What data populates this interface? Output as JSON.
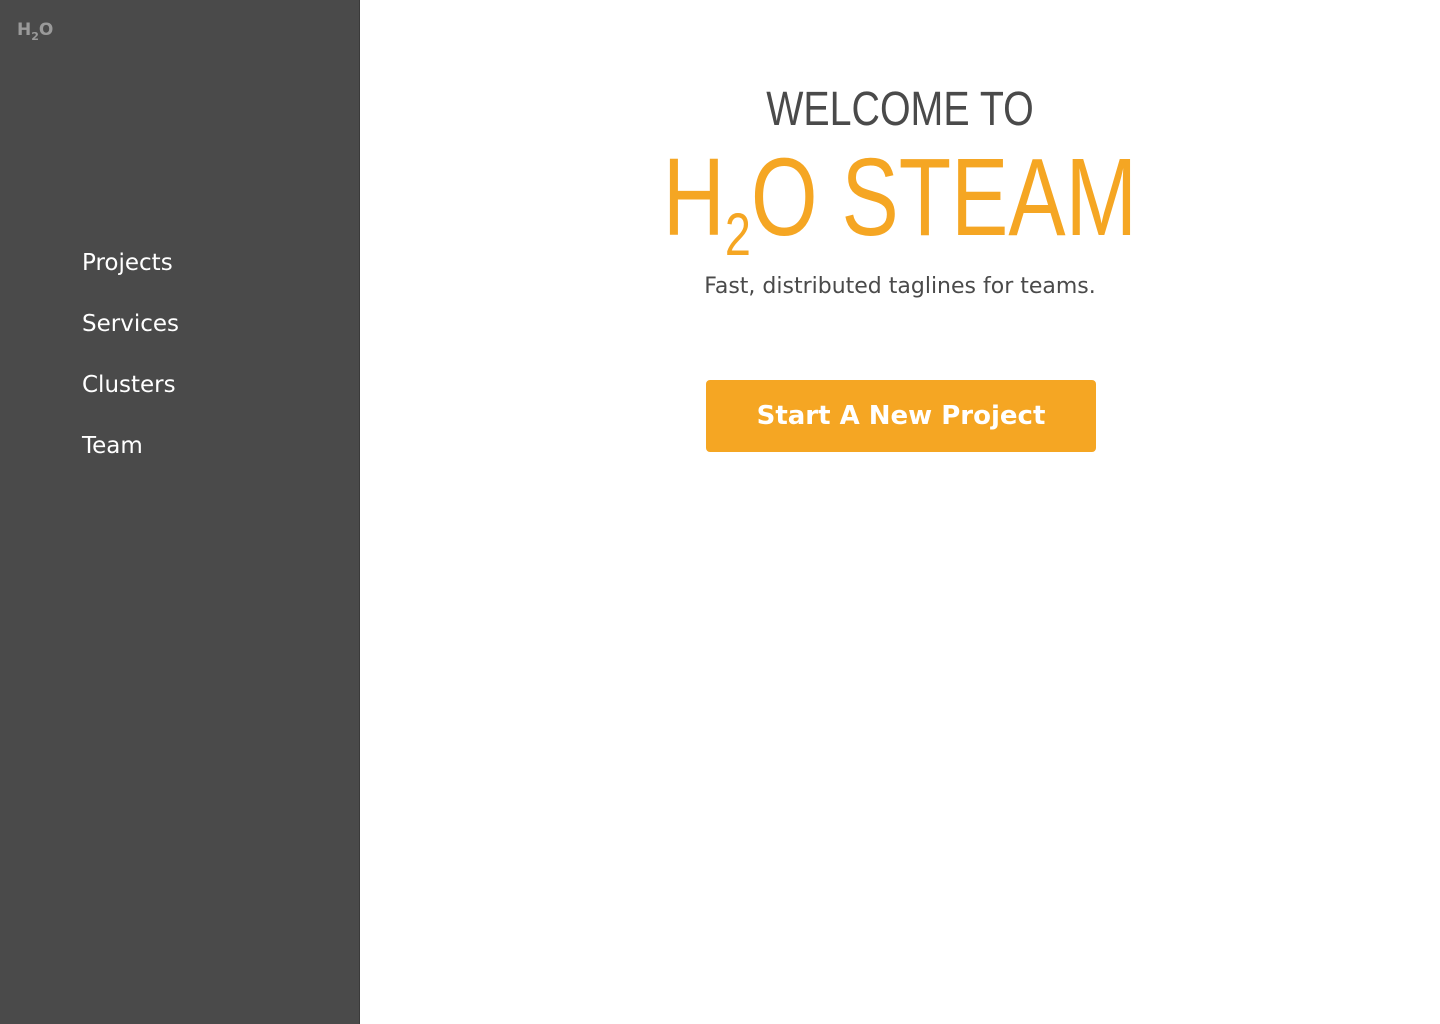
{
  "app": {
    "logo": {
      "main": "H",
      "subscript": "2",
      "tail": "O"
    }
  },
  "sidebar": {
    "items": [
      {
        "label": "Projects"
      },
      {
        "label": "Services"
      },
      {
        "label": "Clusters"
      },
      {
        "label": "Team"
      }
    ]
  },
  "main": {
    "welcome": "WELCOME TO",
    "hero": {
      "prefix": "H",
      "subscript": "2",
      "suffix": "O STEAM"
    },
    "tagline": "Fast, distributed taglines for teams.",
    "cta_label": "Start A New Project"
  },
  "colors": {
    "sidebar_bg": "#4a4a4a",
    "accent": "#f5a623",
    "text_dark": "#4a4a4a",
    "text_light": "#ffffff"
  }
}
